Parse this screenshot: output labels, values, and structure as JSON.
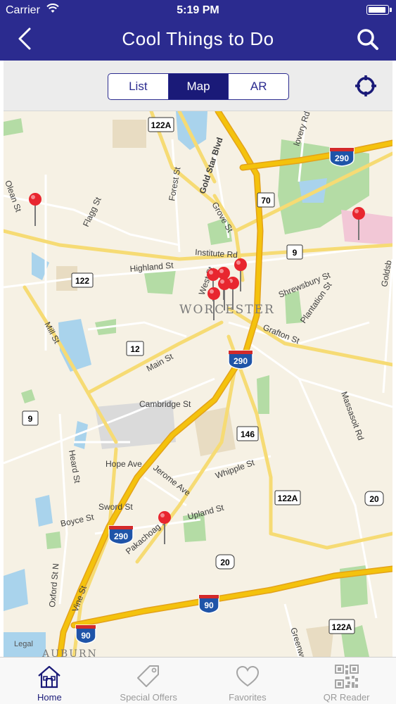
{
  "status_bar": {
    "carrier": "Carrier",
    "time": "5:19 PM"
  },
  "header": {
    "title": "Cool Things to Do"
  },
  "segments": [
    {
      "label": "List",
      "active": false
    },
    {
      "label": "Map",
      "active": true
    },
    {
      "label": "AR",
      "active": false
    }
  ],
  "map": {
    "city_label": "WORCESTER",
    "legal": "Legal",
    "town_label": "AUBURN",
    "streets": {
      "gold_star": "Gold Star Blvd",
      "forest": "Forest St",
      "grove": "Grove St",
      "flagg": "Flagg St",
      "institute": "Institute Rd",
      "highland": "Highland St",
      "west": "West St",
      "shrewsbury": "Shrewsbury St",
      "plantation": "Plantation St",
      "grafton": "Grafton St",
      "main": "Main St",
      "mill": "Mill St",
      "cambridge": "Cambridge St",
      "hope": "Hope Ave",
      "jerome": "Jerome Ave",
      "whipple": "Whipple St",
      "sword": "Sword St",
      "boyce": "Boyce St",
      "upland": "Upland St",
      "pakachoag": "Pakachoag St",
      "heard": "Heard St",
      "oxford": "Oxford St N",
      "vine": "Vine St",
      "massasoit": "Massasoit Rd",
      "greenwood": "Greenwood",
      "lovery": "lovery Rd",
      "olean": "Olean St",
      "goldsb": "Goldsb"
    },
    "shields": {
      "s122a_top": "122A",
      "s290_top": "290",
      "s70": "70",
      "s9_right": "9",
      "s122": "122",
      "s12": "12",
      "s290_mid": "290",
      "s9_left": "9",
      "s146": "146",
      "s122a_mid": "122A",
      "s20_right": "20",
      "s290_bot": "290",
      "s20_bot": "20",
      "s90_mid": "90",
      "s90_left": "90",
      "s122a_bot": "122A"
    }
  },
  "tabs": [
    {
      "label": "Home",
      "icon": "home-icon",
      "active": true
    },
    {
      "label": "Special Offers",
      "icon": "tag-icon",
      "active": false
    },
    {
      "label": "Favorites",
      "icon": "heart-icon",
      "active": false
    },
    {
      "label": "QR Reader",
      "icon": "qr-code-icon",
      "active": false
    }
  ],
  "colors": {
    "header": "#2b2b8f",
    "active_tab": "#1a1a78",
    "pin": "#e8262f",
    "highway": "#f4c20d"
  }
}
